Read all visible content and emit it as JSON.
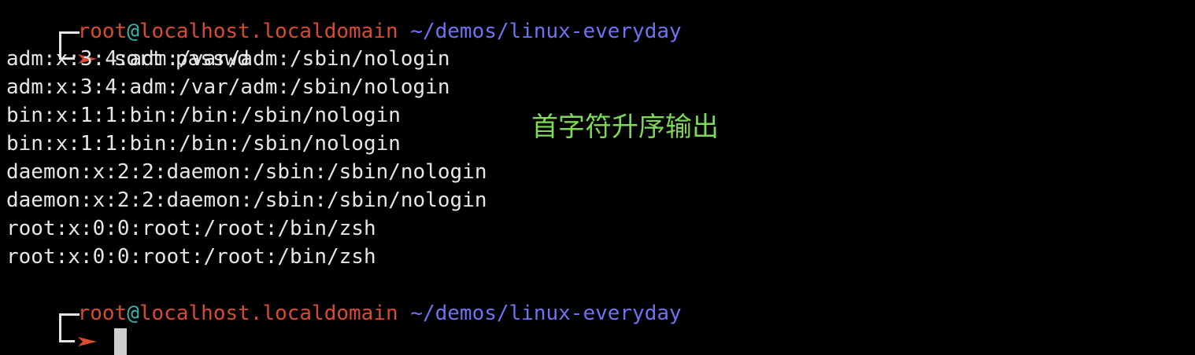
{
  "prompt1": {
    "user": "root",
    "at": "@",
    "host": "localhost.localdomain",
    "path": "~/demos/linux-everyday",
    "command": "sort passwd"
  },
  "output_lines": [
    "adm:x:3:4:adm:/var/adm:/sbin/nologin",
    "adm:x:3:4:adm:/var/adm:/sbin/nologin",
    "bin:x:1:1:bin:/bin:/sbin/nologin",
    "bin:x:1:1:bin:/bin:/sbin/nologin",
    "daemon:x:2:2:daemon:/sbin:/sbin/nologin",
    "daemon:x:2:2:daemon:/sbin:/sbin/nologin",
    "root:x:0:0:root:/root:/bin/zsh",
    "root:x:0:0:root:/root:/bin/zsh"
  ],
  "annotation": "首字符升序输出",
  "prompt2": {
    "user": "root",
    "at": "@",
    "host": "localhost.localdomain",
    "path": "~/demos/linux-everyday"
  },
  "colors": {
    "user_host": "#d94a2f",
    "at_sign": "#38b6b0",
    "path": "#6f72f2",
    "arrow": "#d94a2f",
    "annotation": "#7ed957",
    "background": "#000000",
    "text": "#e6e6e6"
  }
}
